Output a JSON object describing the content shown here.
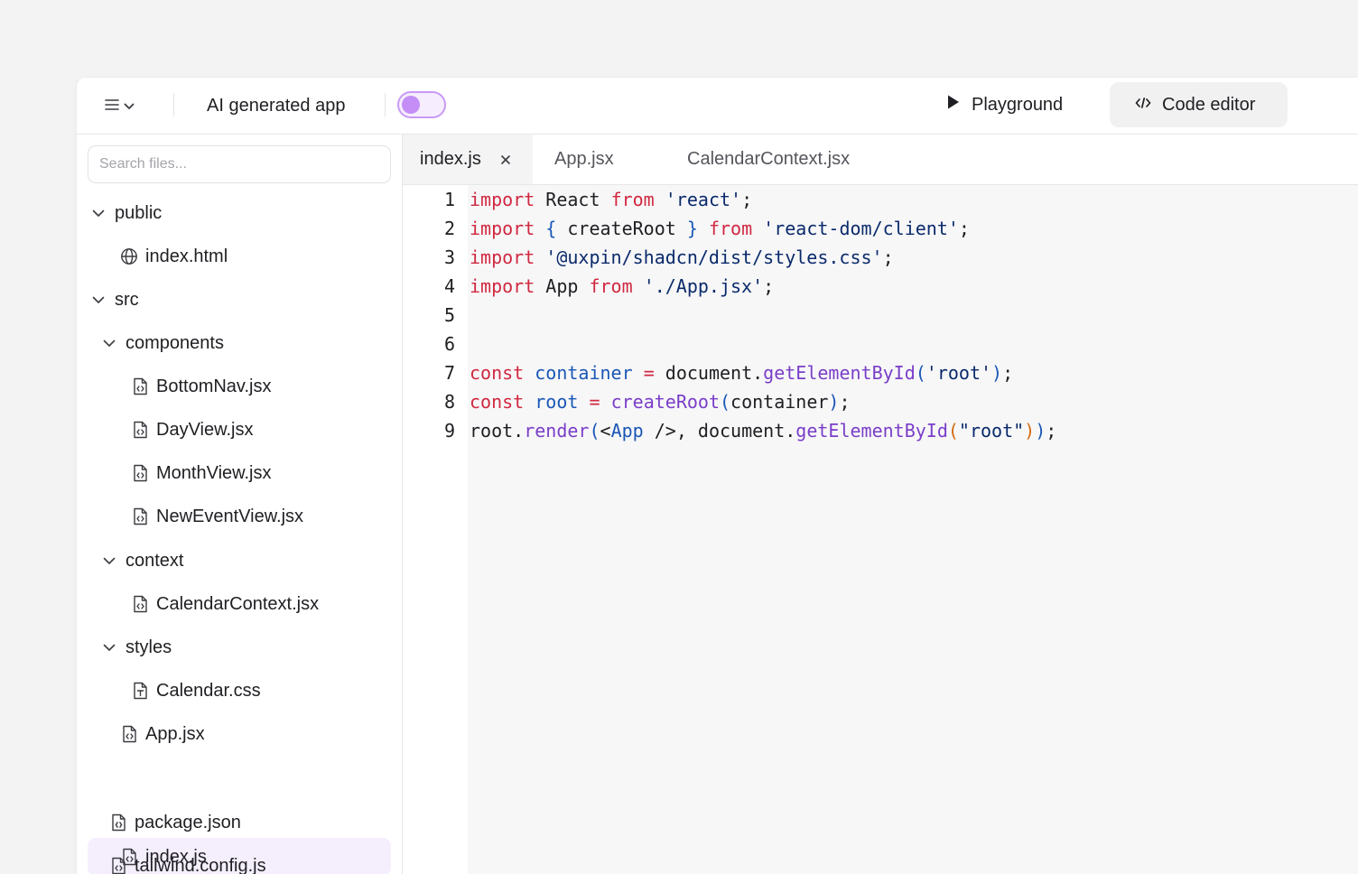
{
  "topbar": {
    "app_title": "AI generated app",
    "playground_label": "Playground",
    "code_editor_label": "Code editor",
    "toggle_on": false,
    "accent_color": "#c48ef6"
  },
  "sidebar": {
    "search_placeholder": "Search files...",
    "tree": {
      "public": "public",
      "index_html": "index.html",
      "src": "src",
      "components": "components",
      "bottomnav": "BottomNav.jsx",
      "dayview": "DayView.jsx",
      "monthview": "MonthView.jsx",
      "neweventview": "NewEventView.jsx",
      "context": "context",
      "calendarcontext": "CalendarContext.jsx",
      "styles": "styles",
      "calendar_css": "Calendar.css",
      "app_jsx": "App.jsx",
      "index_js": "index.js",
      "package_json": "package.json",
      "tailwind": "tailwind.config.js"
    },
    "selected": "index.js"
  },
  "editor": {
    "tabs": {
      "t0": "index.js",
      "t1": "App.jsx",
      "t2": "CalendarContext.jsx"
    },
    "line_numbers": [
      "1",
      "2",
      "3",
      "4",
      "5",
      "6",
      "7",
      "8",
      "9"
    ],
    "code": {
      "import": "import",
      "from": "from",
      "const": "const",
      "react_ident": "React",
      "react_str": "'react'",
      "create_root_braced": "createRoot",
      "open_brace": "{",
      "close_brace": "}",
      "react_dom_str": "'react-dom/client'",
      "styles_str": "'@uxpin/shadcn/dist/styles.css'",
      "app_ident": "App",
      "app_str": "'./App.jsx'",
      "semi": ";",
      "container": "container",
      "root": "root",
      "document": "document",
      "get_by_id": "getElementById",
      "root_sq": "'root'",
      "root_dq": "\"root\"",
      "create_root": "createRoot",
      "render": "render",
      "app_tag": "App",
      "lt": "<",
      "tag_close": "/>",
      "comma": ",",
      "eq": "=",
      "dot": ".",
      "lp": "(",
      "rp": ")"
    }
  }
}
